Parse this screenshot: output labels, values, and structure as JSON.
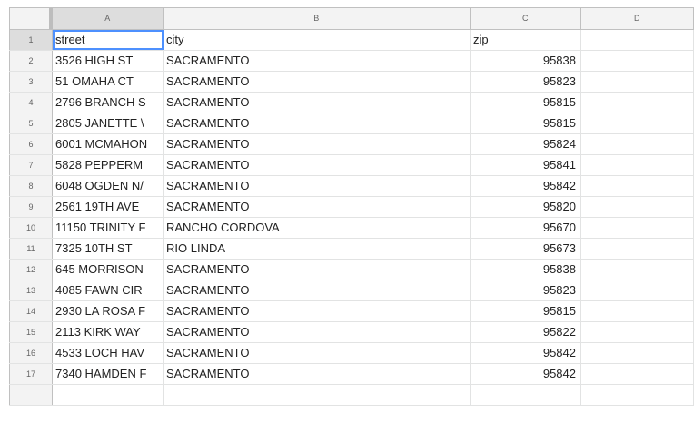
{
  "columns": [
    "A",
    "B",
    "C",
    "D"
  ],
  "rows": [
    {
      "num": "1",
      "street": "street",
      "city": "city",
      "zip": "zip",
      "d": ""
    },
    {
      "num": "2",
      "street": "3526 HIGH ST",
      "city": "SACRAMENTO",
      "zip": "95838",
      "d": ""
    },
    {
      "num": "3",
      "street": "51 OMAHA CT",
      "city": "SACRAMENTO",
      "zip": "95823",
      "d": ""
    },
    {
      "num": "4",
      "street": "2796 BRANCH S",
      "city": "SACRAMENTO",
      "zip": "95815",
      "d": ""
    },
    {
      "num": "5",
      "street": "2805 JANETTE \\",
      "city": "SACRAMENTO",
      "zip": "95815",
      "d": ""
    },
    {
      "num": "6",
      "street": "6001 MCMAHON",
      "city": "SACRAMENTO",
      "zip": "95824",
      "d": ""
    },
    {
      "num": "7",
      "street": "5828 PEPPERM",
      "city": "SACRAMENTO",
      "zip": "95841",
      "d": ""
    },
    {
      "num": "8",
      "street": "6048 OGDEN N/",
      "city": "SACRAMENTO",
      "zip": "95842",
      "d": ""
    },
    {
      "num": "9",
      "street": "2561 19TH AVE",
      "city": "SACRAMENTO",
      "zip": "95820",
      "d": ""
    },
    {
      "num": "10",
      "street": "11150 TRINITY F",
      "city": "RANCHO CORDOVA",
      "zip": "95670",
      "d": ""
    },
    {
      "num": "11",
      "street": "7325 10TH ST",
      "city": "RIO LINDA",
      "zip": "95673",
      "d": ""
    },
    {
      "num": "12",
      "street": "645 MORRISON",
      "city": "SACRAMENTO",
      "zip": "95838",
      "d": ""
    },
    {
      "num": "13",
      "street": "4085 FAWN CIR",
      "city": "SACRAMENTO",
      "zip": "95823",
      "d": ""
    },
    {
      "num": "14",
      "street": "2930 LA ROSA F",
      "city": "SACRAMENTO",
      "zip": "95815",
      "d": ""
    },
    {
      "num": "15",
      "street": "2113 KIRK WAY",
      "city": "SACRAMENTO",
      "zip": "95822",
      "d": ""
    },
    {
      "num": "16",
      "street": "4533 LOCH HAV",
      "city": "SACRAMENTO",
      "zip": "95842",
      "d": ""
    },
    {
      "num": "17",
      "street": "7340 HAMDEN F",
      "city": "SACRAMENTO",
      "zip": "95842",
      "d": ""
    }
  ],
  "selection": {
    "cell": "A1"
  },
  "colors": {
    "selection": "#4d90fe",
    "header_bg": "#f3f3f3",
    "grid": "#e2e3e3"
  }
}
